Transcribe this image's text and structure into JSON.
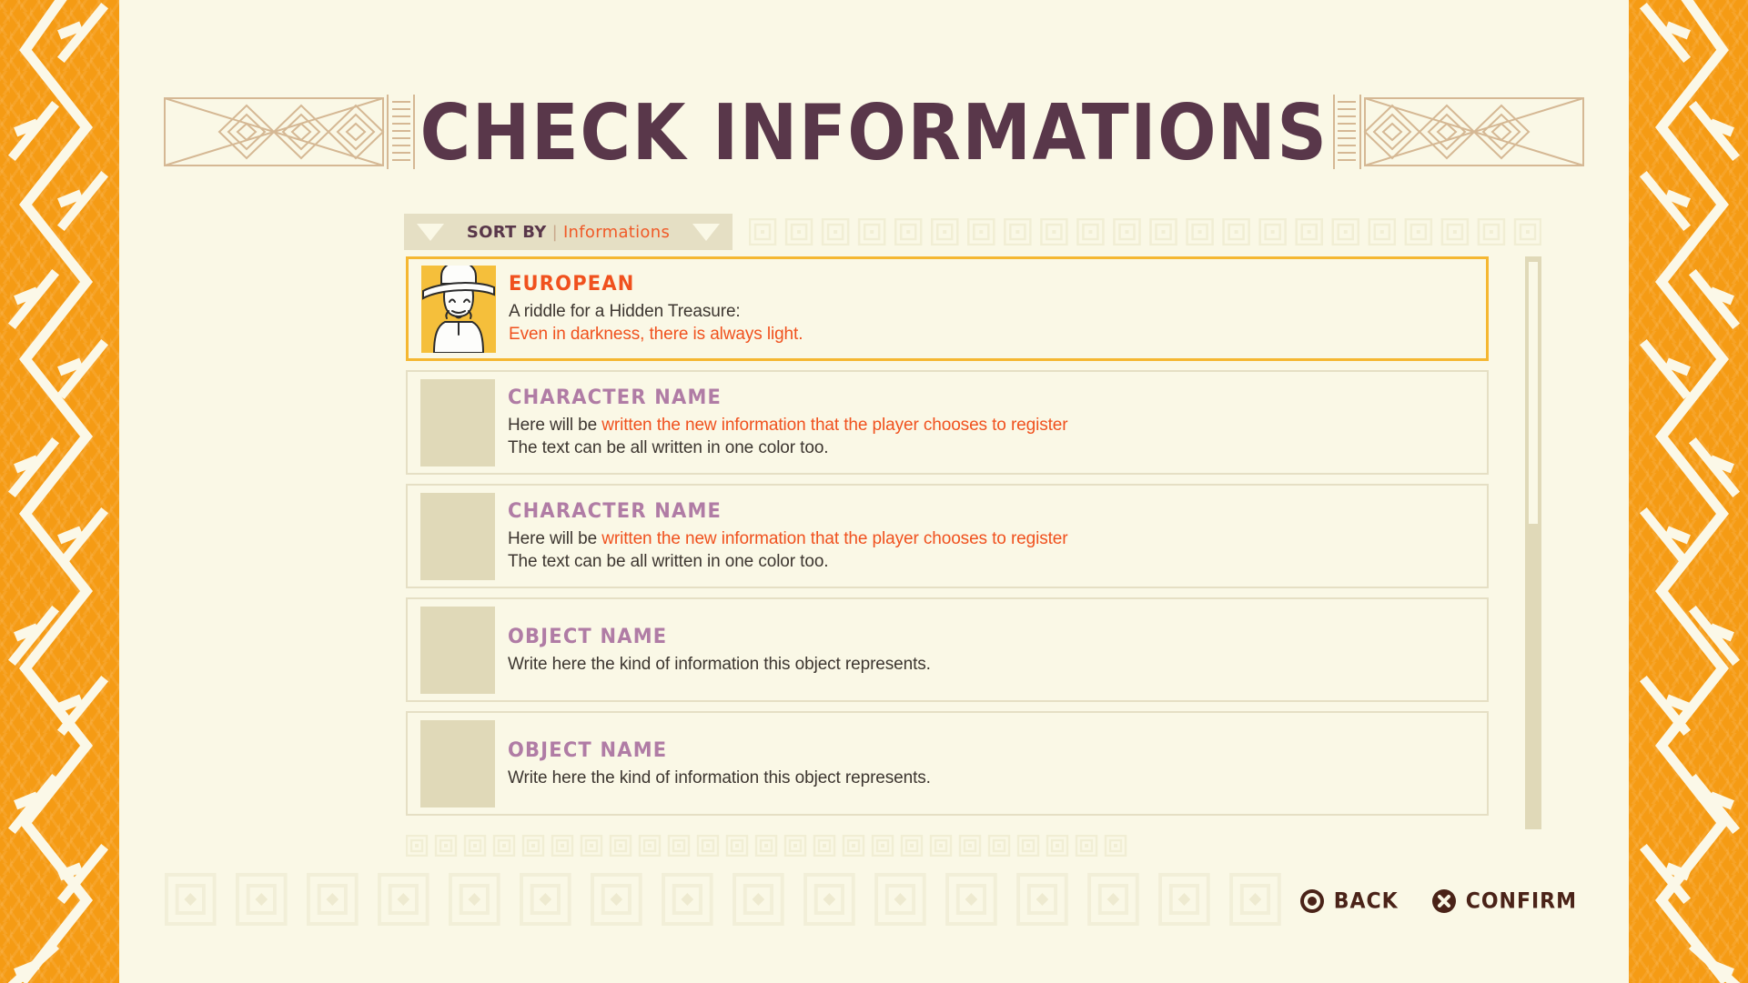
{
  "header": {
    "title": "CHECK INFORMATIONS",
    "ornament_left": "diamond-band-ornament",
    "ornament_right": "diamond-band-ornament"
  },
  "sort": {
    "label": "SORT BY",
    "separator": "|",
    "value": "Informations",
    "prev_icon": "triangle-left-icon",
    "next_icon": "triangle-right-icon"
  },
  "list": {
    "items": [
      {
        "title": "EUROPEAN",
        "title_color": "#f0511e",
        "selected": true,
        "thumb": "european-portrait",
        "line1": "A riddle for a Hidden Treasure:",
        "line1_accent": "",
        "line2": "",
        "line2_accent": "Even in darkness, there is always light."
      },
      {
        "title": "CHARACTER NAME",
        "title_color": "#b07ca5",
        "selected": false,
        "thumb": "empty-thumb",
        "line1": "Here will be ",
        "line1_accent": "written the new information that the player chooses to register",
        "line2": "The text can be all written in one color too.",
        "line2_accent": ""
      },
      {
        "title": "CHARACTER NAME",
        "title_color": "#b07ca5",
        "selected": false,
        "thumb": "empty-thumb",
        "line1": "Here will be ",
        "line1_accent": "written the new information that the player chooses to register",
        "line2": "The text can be all written in one color too.",
        "line2_accent": ""
      },
      {
        "title": "OBJECT NAME",
        "title_color": "#b07ca5",
        "selected": false,
        "thumb": "empty-thumb",
        "line1": "Write here the kind of information this object represents.",
        "line1_accent": "",
        "line2": "",
        "line2_accent": ""
      },
      {
        "title": "OBJECT NAME",
        "title_color": "#b07ca5",
        "selected": false,
        "thumb": "empty-thumb",
        "line1": "Write here the kind of information this object represents.",
        "line1_accent": "",
        "line2": "",
        "line2_accent": ""
      }
    ],
    "scroll_position_percent": 0
  },
  "footer": {
    "back_label": "BACK",
    "back_icon": "circle-filled-icon",
    "confirm_label": "CONFIRM",
    "confirm_icon": "circle-x-icon"
  },
  "colors": {
    "background": "#faf8e6",
    "border_orange": "#f59b14",
    "accent_red": "#f0511e",
    "accent_purple": "#b07ca5",
    "title_plum": "#59374a",
    "beige": "#e5dfc4",
    "thumb_beige": "#e0d9b8",
    "selected_gold": "#f5b731",
    "button_brown": "#4a2318",
    "portrait_gold": "#f5bf3b"
  }
}
